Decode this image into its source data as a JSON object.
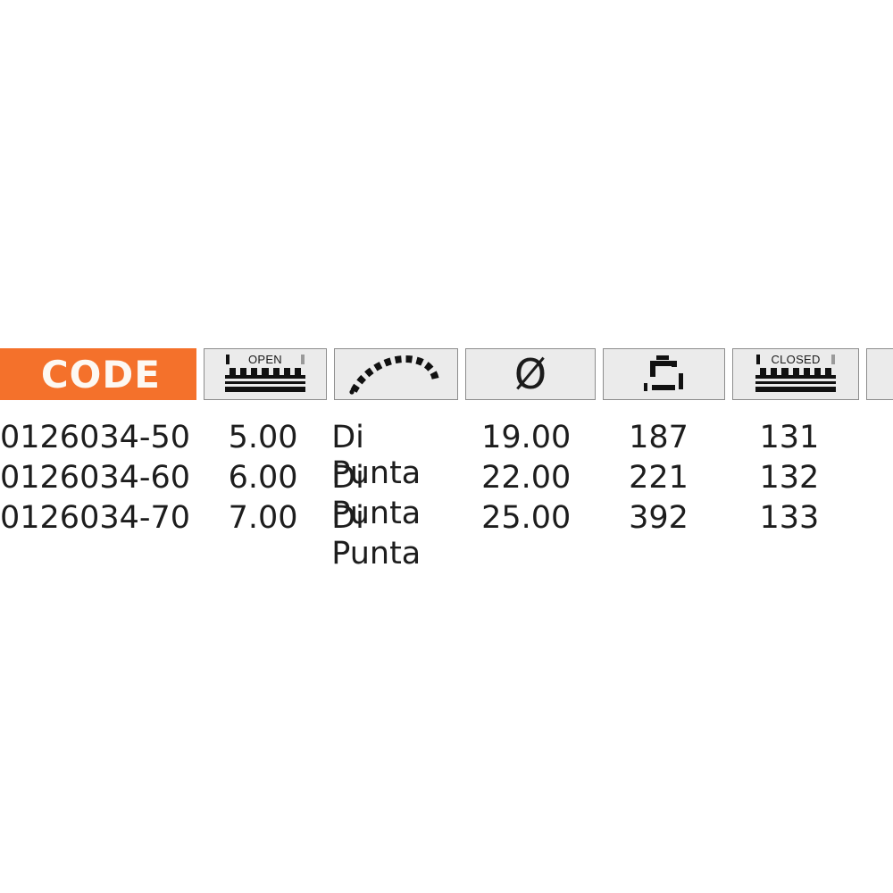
{
  "table": {
    "columns": [
      {
        "key": "code",
        "name": "code-column",
        "header_type": "text",
        "header_label": "CODE",
        "icon": null
      },
      {
        "key": "open",
        "name": "open-width-column",
        "header_type": "icon",
        "header_label": "OPEN",
        "icon": "caliper-open-icon"
      },
      {
        "key": "type",
        "name": "tip-type-column",
        "header_type": "icon",
        "header_label": "",
        "icon": "curved-tip-icon"
      },
      {
        "key": "diameter",
        "name": "diameter-column",
        "header_type": "icon",
        "header_label": "Ø",
        "icon": "diameter-icon"
      },
      {
        "key": "length",
        "name": "length-column",
        "header_type": "icon",
        "header_label": "",
        "icon": "clamp-dimension-icon"
      },
      {
        "key": "closed",
        "name": "closed-width-column",
        "header_type": "icon",
        "header_label": "CLOSED",
        "icon": "caliper-closed-icon"
      },
      {
        "key": "extra",
        "name": "partial-column",
        "header_type": "icon",
        "header_label": "",
        "icon": null
      }
    ],
    "rows": [
      {
        "code": "0126034-50",
        "open": "5.00",
        "type": "Di Punta",
        "diameter": "19.00",
        "length": "187",
        "closed": "131"
      },
      {
        "code": "0126034-60",
        "open": "6.00",
        "type": "Di Punta",
        "diameter": "22.00",
        "length": "221",
        "closed": "132"
      },
      {
        "code": "0126034-70",
        "open": "7.00",
        "type": "Di Punta",
        "diameter": "25.00",
        "length": "392",
        "closed": "133"
      }
    ]
  },
  "colors": {
    "code_header_background": "#f4712b",
    "code_header_text": "#fdf8f2",
    "header_cell_background": "#ebebeb",
    "header_cell_border": "#8d8d8d",
    "page_background": "#ffffff",
    "body_text": "#1d1d1d"
  }
}
